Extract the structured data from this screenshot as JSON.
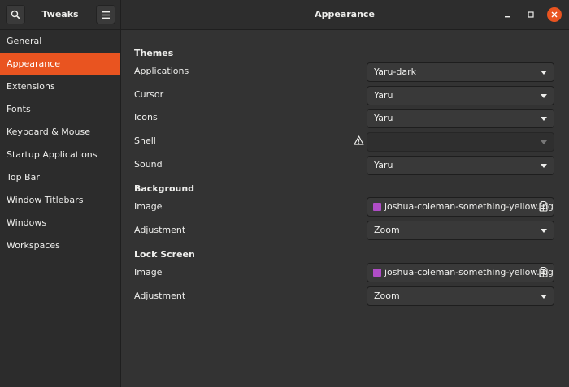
{
  "header": {
    "app_title": "Tweaks",
    "page_title": "Appearance"
  },
  "sidebar": {
    "items": [
      {
        "label": "General"
      },
      {
        "label": "Appearance",
        "active": true
      },
      {
        "label": "Extensions"
      },
      {
        "label": "Fonts"
      },
      {
        "label": "Keyboard & Mouse"
      },
      {
        "label": "Startup Applications"
      },
      {
        "label": "Top Bar"
      },
      {
        "label": "Window Titlebars"
      },
      {
        "label": "Windows"
      },
      {
        "label": "Workspaces"
      }
    ]
  },
  "themes": {
    "heading": "Themes",
    "applications": {
      "label": "Applications",
      "value": "Yaru-dark"
    },
    "cursor": {
      "label": "Cursor",
      "value": "Yaru"
    },
    "icons": {
      "label": "Icons",
      "value": "Yaru"
    },
    "shell": {
      "label": "Shell",
      "value": ""
    },
    "sound": {
      "label": "Sound",
      "value": "Yaru"
    }
  },
  "background": {
    "heading": "Background",
    "image": {
      "label": "Image",
      "value": "joshua-coleman-something-yellow.jpg"
    },
    "adjustment": {
      "label": "Adjustment",
      "value": "Zoom"
    }
  },
  "lock_screen": {
    "heading": "Lock Screen",
    "image": {
      "label": "Image",
      "value": "joshua-coleman-something-yellow.jpg"
    },
    "adjustment": {
      "label": "Adjustment",
      "value": "Zoom"
    }
  },
  "colors": {
    "accent": "#e95420",
    "file_icon": "#b04dc7"
  },
  "icons": {
    "search": "search-icon",
    "menu": "hamburger-menu-icon",
    "minimize": "minimize-icon",
    "maximize": "maximize-icon",
    "close": "close-icon",
    "warning": "warning-icon",
    "file": "image-file-icon",
    "open": "document-open-icon"
  }
}
